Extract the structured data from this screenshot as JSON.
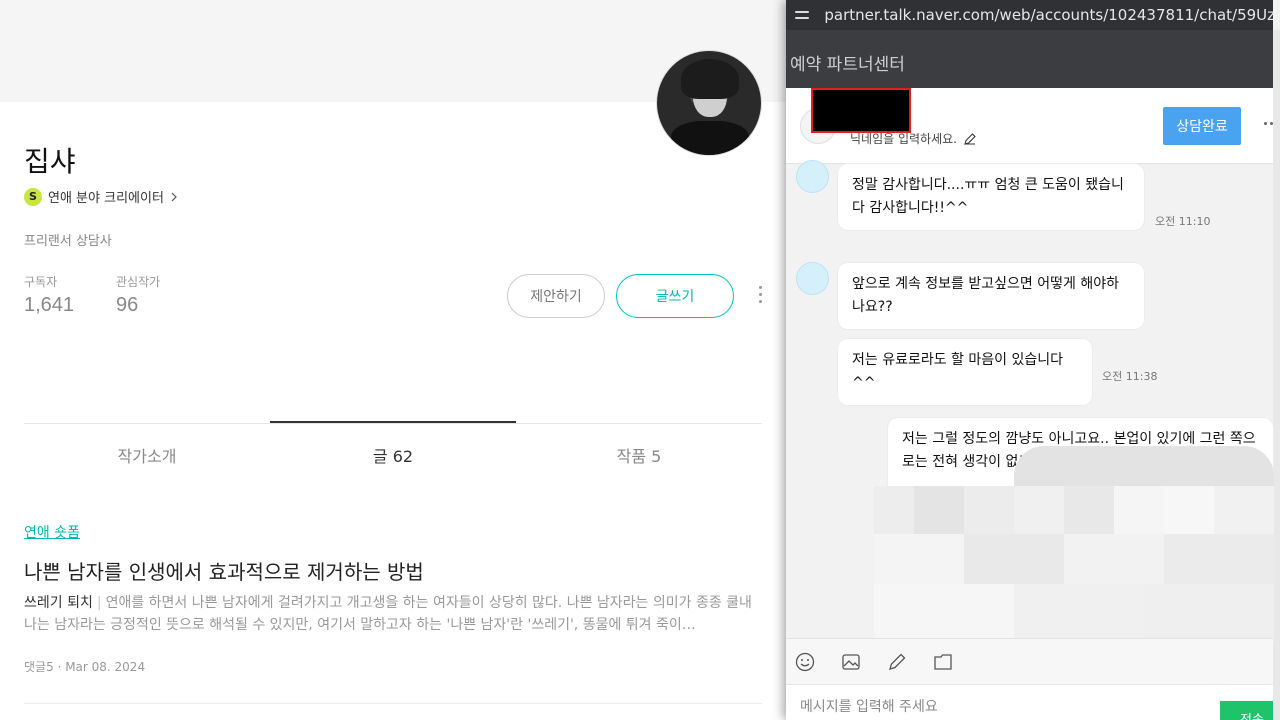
{
  "profile": {
    "name": "집샤",
    "badge_letter": "S",
    "category": "연애 분야 크리에이터",
    "job": "프리랜서 상담사",
    "subscribers_label": "구독자",
    "subscribers": "1,641",
    "following_label": "관심작가",
    "following": "96",
    "propose_label": "제안하기",
    "write_label": "글쓰기"
  },
  "tabs": [
    {
      "label": "작가소개"
    },
    {
      "label": "글 62"
    },
    {
      "label": "작품 5"
    }
  ],
  "post": {
    "category": "연애 숏폼",
    "title": "나쁜 남자를 인생에서 효과적으로 제거하는 방법",
    "subtitle": "쓰레기 퇴치",
    "excerpt": "연애를 하면서 나쁜 남자에게 걸려가지고 개고생을 하는 여자들이 상당히 많다. 나쁜 남자라는 의미가 종종 쿨내 나는 남자라는 긍정적인 뜻으로 해석될 수 있지만, 여기서 말하고자 하는 '나쁜 남자'란 '쓰레기', 똥물에 튀겨 죽이…",
    "comments": "댓글5",
    "date": "Mar 08. 2024"
  },
  "chat": {
    "url": "partner.talk.naver.com/web/accounts/102437811/chat/59Uz...",
    "app_title": "예약 파트너센터",
    "nickname_placeholder": "닉네임을 입력하세요.",
    "done_button": "상담완료",
    "messages": [
      {
        "text": "정말 감사합니다....ㅠㅠ 엄청 큰 도움이 됐습니다 감사합니다!!^^",
        "time": "오전 11:10"
      },
      {
        "text": "앞으로 계속 정보를 받고싶으면 어떻게 해야하나요??",
        "time": ""
      },
      {
        "text": "저는 유료로라도 할 마음이 있습니다^^",
        "time": "오전 11:38"
      },
      {
        "text": "저는 그럴 정도의 깜냥도 아니고요.. 본업이 있기에 그런 쪽으로는 전혀 생각이 없고 그",
        "time": ""
      }
    ],
    "input_placeholder": "메시지를 입력해 주세요",
    "send_label": "전송"
  },
  "icons": [
    "settings-icon",
    "pencil-icon",
    "emoji-icon",
    "image-icon",
    "edit-icon",
    "folder-icon"
  ]
}
